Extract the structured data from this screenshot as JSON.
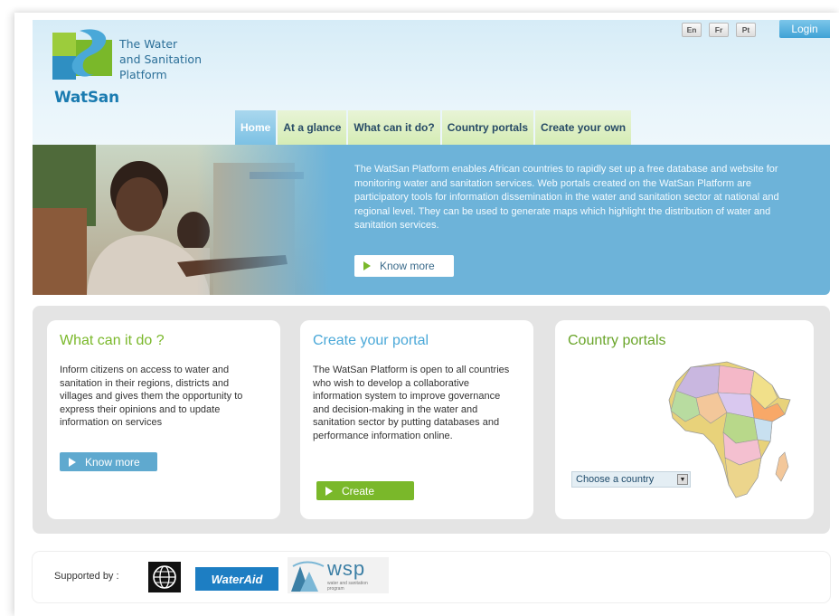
{
  "header": {
    "logo_brand": "WatSan",
    "logo_tagline": [
      "The Water",
      "and Sanitation",
      "Platform"
    ],
    "languages": [
      "En",
      "Fr",
      "Pt"
    ],
    "login_label": "Login"
  },
  "nav": {
    "items": [
      {
        "label": "Home",
        "active": true
      },
      {
        "label": "At a glance",
        "active": false
      },
      {
        "label": "What can it do?",
        "active": false
      },
      {
        "label": "Country portals",
        "active": false
      },
      {
        "label": "Create your own",
        "active": false
      }
    ]
  },
  "hero": {
    "text": "The WatSan Platform enables African countries to rapidly set up a free database and website for monitoring water and sanitation services. Web portals created on the WatSan Platform are participatory tools for information dissemination in the water and sanitation sector at national and regional level. They can be used to generate maps which highlight the distribution of water and sanitation services.",
    "button_label": "Know more"
  },
  "cards": {
    "what": {
      "title": "What can it do ?",
      "body": "Inform citizens on access to water and sanitation in their regions, districts and villages and gives them the opportunity to express their opinions and to update information on services",
      "button_label": "Know more"
    },
    "create": {
      "title": "Create your portal",
      "body": "The WatSan Platform is open to all countries who wish to develop a collaborative information system to improve governance and decision-making in the water and sanitation sector by putting databases and performance information online.",
      "button_label": "Create"
    },
    "portals": {
      "title": "Country portals",
      "select_value": "Choose a country"
    }
  },
  "footer": {
    "supported_label": "Supported by :",
    "wateraid_label": "WaterAid",
    "wsp_label": "wsp",
    "wsp_sub": "water and sanitation program"
  },
  "colors": {
    "accent_blue": "#6db3d9",
    "accent_green": "#7ab82a",
    "nav_active": "#7cc1e4"
  }
}
